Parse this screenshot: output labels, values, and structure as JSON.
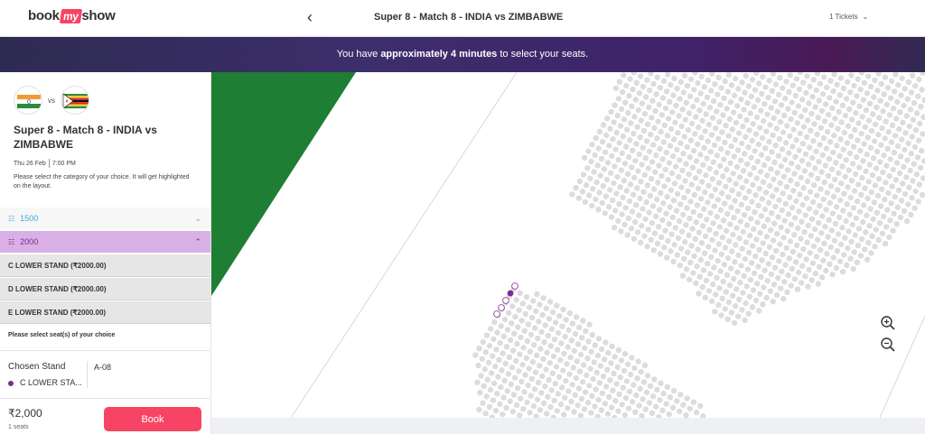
{
  "header": {
    "logo_left": "book",
    "logo_mid": "my",
    "logo_right": "show",
    "back_icon": "chevron-left-icon",
    "title": "Super 8 - Match 8 - INDIA vs ZIMBABWE",
    "tickets_label": "1 Tickets",
    "tickets_icon": "chevron-down-icon"
  },
  "banner": {
    "prefix": "You have ",
    "highlight": "approximately 4 minutes",
    "suffix": " to select your seats."
  },
  "event": {
    "vs": "vs",
    "name": "Super 8 - Match 8 - INDIA vs ZIMBABWE",
    "date": "Thu 26 Feb",
    "time": "7:00 PM",
    "help": "Please select the category of your choice. It will get highlighted on the layout."
  },
  "categories": [
    {
      "label": "1500",
      "color": "#40a9e0",
      "expanded": false
    },
    {
      "label": "2000",
      "color": "#7a2b8f",
      "expanded": true
    }
  ],
  "stands": [
    "C LOWER STAND (₹2000.00)",
    "D LOWER STAND (₹2000.00)",
    "E LOWER STAND (₹2000.00)"
  ],
  "selection": {
    "prompt": "Please select seat(s) of your choice",
    "chosen_label": "Chosen Stand",
    "chosen_stand": "C LOWER STA...",
    "seat": "A-08"
  },
  "footer": {
    "price": "₹2,000",
    "seats": "1 seats",
    "book_label": "Book"
  },
  "colors": {
    "accent": "#f84464",
    "banner": "#3d2e6c",
    "selected": "#7a2b8f",
    "pitch": "#1e7e34",
    "seat": "#dcdcdc"
  }
}
